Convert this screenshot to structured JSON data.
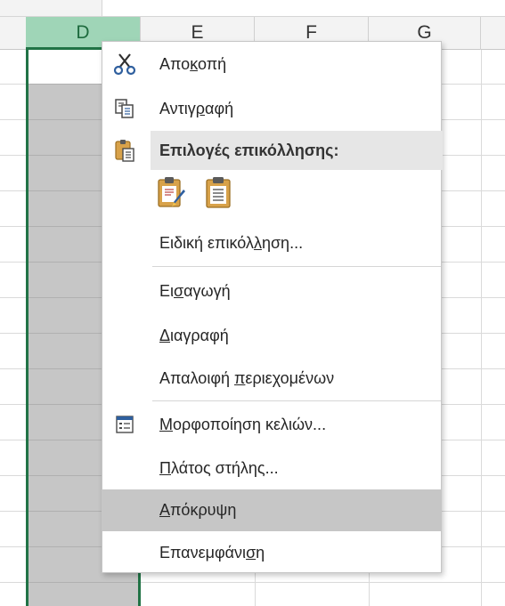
{
  "spreadsheet": {
    "columns": [
      "D",
      "E",
      "F",
      "G"
    ],
    "selected_column": "D"
  },
  "context_menu": {
    "cut": {
      "pre": "Απο",
      "key": "κ",
      "post": "οπή",
      "icon": "scissors-icon"
    },
    "copy": {
      "pre": "Αντιγ",
      "key": "ρ",
      "post": "αφή",
      "icon": "copy-icon"
    },
    "paste_options_header": {
      "label": "Επιλογές επικόλλησης:",
      "icon": "paste-icon"
    },
    "paste_options": [
      {
        "icon": "paste-formatting-icon"
      },
      {
        "icon": "paste-values-icon"
      }
    ],
    "paste_special": {
      "pre": "Ειδική επικόλ",
      "key": "λ",
      "post": "ηση..."
    },
    "insert": {
      "pre": "Ει",
      "key": "σ",
      "post": "αγωγή"
    },
    "delete": {
      "pre": "",
      "key": "Δ",
      "post": "ιαγραφή"
    },
    "clear_contents": {
      "pre": "Απαλοιφή ",
      "key": "π",
      "post": "εριεχομένων"
    },
    "format_cells": {
      "pre": "",
      "key": "Μ",
      "post": "ορφοποίηση κελιών...",
      "icon": "format-cells-icon"
    },
    "column_width": {
      "pre": "",
      "key": "Π",
      "post": "λάτος στήλης..."
    },
    "hide": {
      "pre": "",
      "key": "Α",
      "post": "πόκρυψη"
    },
    "unhide": {
      "pre": "Επανεμφάνι",
      "key": "σ",
      "post": "η"
    }
  },
  "colors": {
    "accent_green": "#217346",
    "selected_header_bg": "#9fd5b7",
    "highlight_bg": "#c6c6c6"
  }
}
